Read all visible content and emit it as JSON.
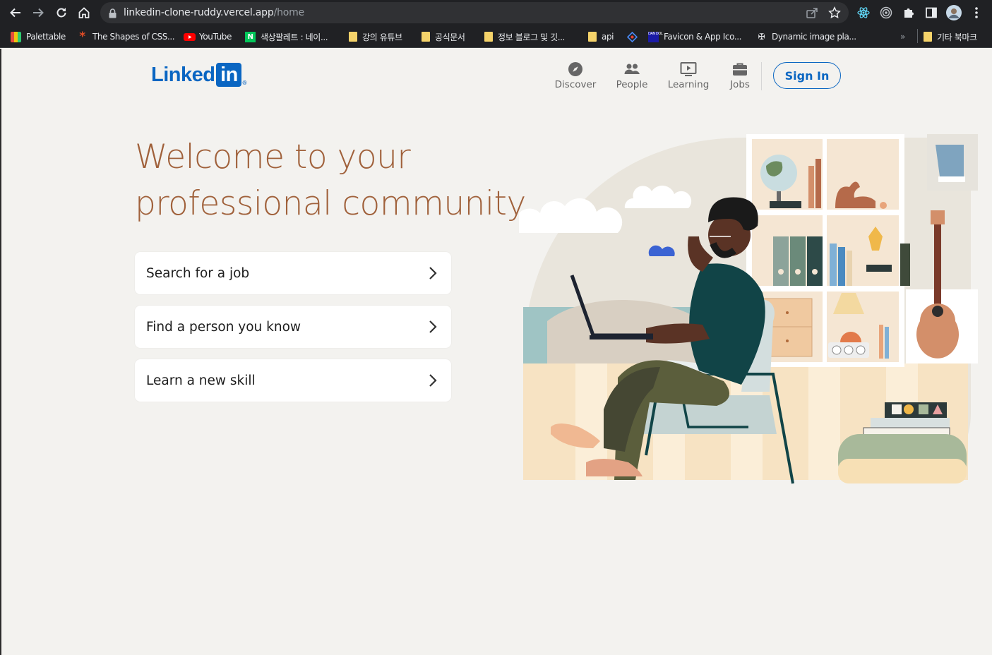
{
  "browser": {
    "url_host": "linkedin-clone-ruddy.vercel.app",
    "url_path": "/home",
    "bookmarks": [
      {
        "label": "Palettable",
        "icon": "palette-icon"
      },
      {
        "label": "The Shapes of CSS...",
        "icon": "asterisk-icon"
      },
      {
        "label": "YouTube",
        "icon": "youtube-icon"
      },
      {
        "label": "색상팔레트 : 네이...",
        "icon": "naver-icon"
      },
      {
        "label": "강의 유튜브",
        "icon": "folder-icon"
      },
      {
        "label": "공식문서",
        "icon": "folder-icon"
      },
      {
        "label": "정보 블로그 및 깃...",
        "icon": "folder-icon"
      },
      {
        "label": "api",
        "icon": "folder-icon"
      },
      {
        "label": "Favicon & App Ico...",
        "icon": "favicon-icon"
      },
      {
        "label": "Dynamic image pla...",
        "icon": "image-placeholder-icon"
      }
    ],
    "overflow": "»",
    "other_bookmarks": "기타 북마크"
  },
  "header": {
    "logo_text": "Linked",
    "logo_box": "in",
    "logo_reg": "®",
    "nav": [
      {
        "label": "Discover",
        "icon": "compass-icon"
      },
      {
        "label": "People",
        "icon": "people-icon"
      },
      {
        "label": "Learning",
        "icon": "play-video-icon"
      },
      {
        "label": "Jobs",
        "icon": "briefcase-icon"
      }
    ],
    "signin_label": "Sign In"
  },
  "hero": {
    "title_line1": "Welcome to your",
    "title_line2": "professional community"
  },
  "actions": [
    {
      "label": "Search for a job"
    },
    {
      "label": "Find a person you know"
    },
    {
      "label": "Learn a new skill"
    }
  ],
  "colors": {
    "brand_blue": "#0a66c2",
    "hero_brown": "#a0613b",
    "page_bg": "#f3f2ef"
  }
}
